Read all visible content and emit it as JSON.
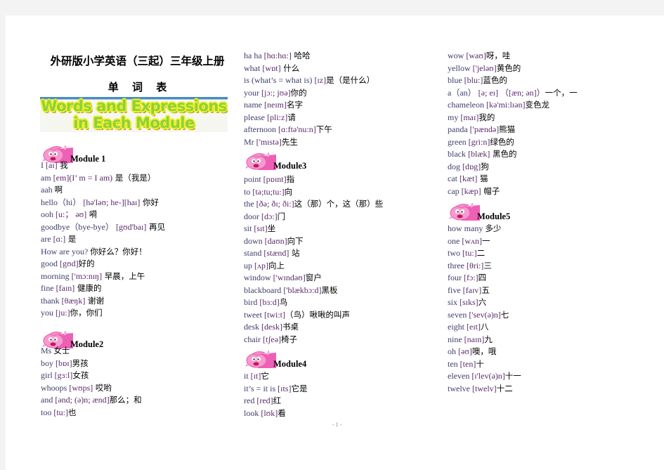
{
  "document": {
    "title": "外研版小学英语（三起）三年级上册",
    "subtitle": "单 词 表",
    "banner": {
      "line1": "Words and Expressions",
      "line2": "in Each Module"
    },
    "page_number": "- 1 -"
  },
  "modules": [
    {
      "label": "Module  1",
      "entries": [
        {
          "en": "I",
          "ph": "[aɪ]",
          "zh": " 我"
        },
        {
          "en": "am",
          "ph": "[em](I’ m = I am)",
          "zh": " 是（我是）"
        },
        {
          "en": "aah",
          "ph": "",
          "zh": " 啊"
        },
        {
          "en": "hello（hi）",
          "ph": "[hə'ləʊ; he-][haɪ]",
          "zh": " 你好"
        },
        {
          "en": "ooh",
          "ph": "[u:； əʊ]",
          "zh": " 嗬"
        },
        {
          "en": "goodbye（bye-bye）",
          "ph": "[gʊd'baɪ]",
          "zh": " 再见"
        },
        {
          "en": "are",
          "ph": "[ɑ:]",
          "zh": " 是"
        },
        {
          "en": "How are you?",
          "ph": "",
          "zh": "你好么？你好！"
        },
        {
          "en": "good",
          "ph": "[gʊd]",
          "zh": "好的"
        },
        {
          "en": "morning",
          "ph": "['mɔ:nɪŋ]",
          "zh": " 早晨，上午"
        },
        {
          "en": " fine",
          "ph": "[faɪn]",
          "zh": " 健康的"
        },
        {
          "en": "thank",
          "ph": "[θæŋk]",
          "zh": " 谢谢"
        },
        {
          "en": "you",
          "ph": " [ju:]",
          "zh": "你，你们"
        }
      ]
    },
    {
      "label": "Module2",
      "entries": [
        {
          "en": "Ms",
          "ph": "",
          "zh": " 女士"
        },
        {
          "en": "boy",
          "ph": "[bɒɪ]",
          "zh": "男孩"
        },
        {
          "en": "girl",
          "ph": "[gɜ:l]",
          "zh": "女孩"
        },
        {
          "en": "whoops",
          "ph": "[wʊps]",
          "zh": " 哎哟"
        },
        {
          "en": "and",
          "ph": "[ənd; (ə)n; ænd]",
          "zh": "那么；和"
        },
        {
          "en": "too",
          "ph": "[tu:]",
          "zh": "也"
        }
      ]
    },
    {
      "label": "",
      "entries": [
        {
          "en": "ha ha",
          "ph": "[hɑ:hɑ:]",
          "zh": " 哈哈"
        },
        {
          "en": "what",
          "ph": "[wɒt]",
          "zh": " 什么"
        },
        {
          "en": "is (what’s = what is)",
          "ph": "[ɪz]",
          "zh": "是（是什么）"
        },
        {
          "en": "your",
          "ph": "[jɔ:; jʊə]",
          "zh": "你的"
        },
        {
          "en": "name",
          "ph": "[neɪm]",
          "zh": "名字"
        },
        {
          "en": "please",
          "ph": "[pli:z]",
          "zh": "请"
        },
        {
          "en": "afternoon",
          "ph": "[ɑ:ftə'nu:n]",
          "zh": "下午"
        },
        {
          "en": "Mr",
          "ph": "['mɪstə]",
          "zh": "先生"
        }
      ]
    },
    {
      "label": "Module3",
      "entries": [
        {
          "en": "point",
          "ph": "[pɒɪnt]",
          "zh": "指"
        },
        {
          "en": "to",
          "ph": "[tə;tu;tu:]",
          "zh": "向"
        },
        {
          "en": "the",
          "ph": "[ðə; ðɪ; ði:]",
          "zh": "这（那）个，这（那）些"
        },
        {
          "en": "door",
          "ph": "[dɔ:]",
          "zh": "门"
        },
        {
          "en": "sit",
          "ph": "[sɪt]",
          "zh": "坐"
        },
        {
          "en": "down",
          "ph": "[daʊn]",
          "zh": "向下"
        },
        {
          "en": "stand",
          "ph": "[stænd]",
          "zh": " 站"
        },
        {
          "en": "up",
          "ph": "[ʌp]",
          "zh": "向上"
        },
        {
          "en": "window",
          "ph": "['wɪndəʊ]",
          "zh": "窗户"
        },
        {
          "en": "blackboard",
          "ph": "['blækbɔ:d]",
          "zh": "黑板"
        },
        {
          "en": "bird",
          "ph": "[bɜ:d]",
          "zh": "鸟"
        },
        {
          "en": "tweet",
          "ph": "[twi:t]",
          "zh": "（鸟）啾啾的叫声"
        },
        {
          "en": "desk",
          "ph": "[desk]",
          "zh": "书桌"
        },
        {
          "en": "chair",
          "ph": "[tʃeə]",
          "zh": "椅子"
        }
      ]
    },
    {
      "label": "Module4",
      "entries": [
        {
          "en": "it",
          "ph": "[ɪt]",
          "zh": "它"
        },
        {
          "en": "it’s = it is",
          "ph": "[ɪts]",
          "zh": "它是"
        },
        {
          "en": "red",
          "ph": "[red]",
          "zh": "红"
        },
        {
          "en": "look",
          "ph": "[lʊk]",
          "zh": "看"
        }
      ]
    },
    {
      "label": "",
      "entries": [
        {
          "en": "wow",
          "ph": "[waʊ]",
          "zh": "呀，哇"
        },
        {
          "en": "yellow",
          "ph": "['jeləʊ]",
          "zh": "黄色的"
        },
        {
          "en": "blue",
          "ph": "[blu:]",
          "zh": "蓝色的"
        },
        {
          "en": "a（an）",
          "ph": "[ə; eɪ] （[æn; ən]）",
          "zh": "一个，一"
        },
        {
          "en": "chameleon",
          "ph": "[kə'mi:lɪən]",
          "zh": "变色龙"
        },
        {
          "en": "my",
          "ph": "[maɪ]",
          "zh": "我的"
        },
        {
          "en": "panda",
          "ph": "['pændə]",
          "zh": "熊猫"
        },
        {
          "en": "green",
          "ph": "[gri:n]",
          "zh": "绿色的"
        },
        {
          "en": "black",
          "ph": "[blæk]",
          "zh": " 黑色的"
        },
        {
          "en": "dog",
          "ph": "[dɒg]",
          "zh": "狗"
        },
        {
          "en": "cat",
          "ph": "[kæt]",
          "zh": " 猫"
        },
        {
          "en": "cap",
          "ph": "[kæp]",
          "zh": " 帽子"
        }
      ]
    },
    {
      "label": "Module5",
      "entries": [
        {
          "en": "how many",
          "ph": "",
          "zh": " 多少"
        },
        {
          "en": "one",
          "ph": "[wʌn]",
          "zh": "一"
        },
        {
          "en": "two",
          "ph": "[tu:]",
          "zh": "二"
        },
        {
          "en": "three",
          "ph": "[θri:]",
          "zh": "三"
        },
        {
          "en": "four",
          "ph": "[fɔ:]",
          "zh": "四"
        },
        {
          "en": "five",
          "ph": " [faɪv]",
          "zh": "五"
        },
        {
          "en": "six",
          "ph": "[sɪks]",
          "zh": "六"
        },
        {
          "en": "seven",
          "ph": "['sev(ə)n]",
          "zh": "七"
        },
        {
          "en": "eight",
          "ph": "[eɪt]",
          "zh": "八"
        },
        {
          "en": "nine",
          "ph": "[naɪn]",
          "zh": "九"
        },
        {
          "en": "oh",
          "ph": "[əʊ]",
          "zh": "噢，哦"
        },
        {
          "en": "ten",
          "ph": "[ten]",
          "zh": "十"
        },
        {
          "en": "eleven",
          "ph": "[ɪ'lev(ə)n]",
          "zh": "十一"
        },
        {
          "en": "twelve",
          "ph": "[twelv]",
          "zh": "十二"
        }
      ]
    }
  ]
}
